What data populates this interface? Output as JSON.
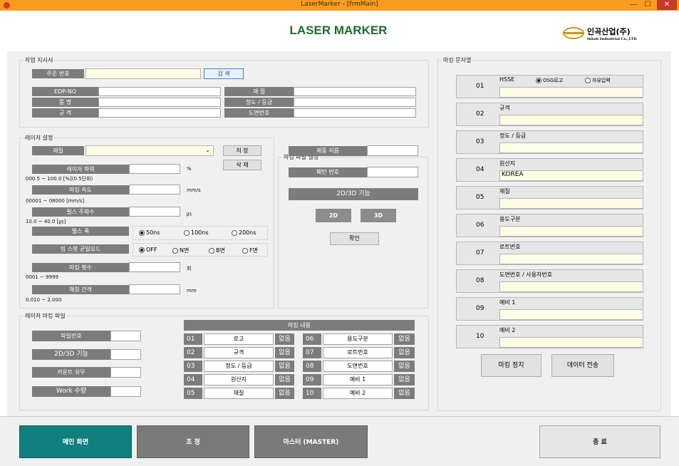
{
  "window": {
    "title": "LaserMarker - [frmMain]",
    "minimize": "—",
    "maximize": "☐",
    "close": "✕"
  },
  "header": {
    "app_title": "LASER MARKER",
    "logo_name": "인곡산업(주)",
    "logo_sub": "Inkok Industrial Co.,LTD"
  },
  "work_order": {
    "group_title": "작업 지시서",
    "order_no_label": "주문 번호",
    "order_no_value": "",
    "search_label": "검 색",
    "edp_label": "EDP-NO",
    "edp_value": "",
    "product_label": "품 명",
    "product_value": "",
    "spec_label": "규 격",
    "spec_value": "",
    "material_label": "재 질",
    "material_value": "",
    "precision_label": "정도 / 등급",
    "precision_value": "",
    "drawing_label": "도면번호",
    "drawing_value": ""
  },
  "laser": {
    "group_title": "레이저 설정",
    "material_label": "재질",
    "material_value": "",
    "save_label": "저 장",
    "delete_label": "삭 제",
    "power_label": "레이저 파워",
    "power_unit": "%",
    "power_range": "000.5 ~ 100.0 [%](0.5단위)",
    "speed_label": "마킹 속도",
    "speed_unit": "mm/s",
    "speed_range": "00001 ~ 08000 [mm/s]",
    "freq_label": "펄스 주파수",
    "freq_unit": "㎲",
    "freq_range": "10.0 ~ 40.0 [㎲]",
    "width_label": "펄스 폭",
    "width_opts": [
      "50ns",
      "100ns",
      "200ns"
    ],
    "beam_label": "빔 스팟 균일모드",
    "beam_opts": [
      "OFF",
      "N면",
      "B면",
      "F면"
    ],
    "count_label": "마킹 횟수",
    "count_unit": "회",
    "count_range": "0001 ~ 9999",
    "hatch_label": "해칭 간격",
    "hatch_unit": "mm",
    "hatch_range": "0.010 ~ 2.000"
  },
  "file_settings": {
    "group_title": "마킹 파일 설정",
    "product_label": "제품 지름",
    "pattern_label": "패턴 번호",
    "func_label": "2D/3D 기능",
    "btn_2d": "2D",
    "btn_3d": "3D",
    "ok_label": "확인"
  },
  "laser_file": {
    "group_title": "레이저 마킹 파일",
    "file_no_label": "파일번호",
    "func_label": "2D/3D 기능",
    "count_label": "카운트 유무",
    "work_label": "Work 수량"
  },
  "marking_contents": {
    "title": "마킹 내용",
    "none": "없음",
    "left": [
      {
        "n": "01",
        "name": "로고"
      },
      {
        "n": "02",
        "name": "규격"
      },
      {
        "n": "03",
        "name": "정도 / 등급"
      },
      {
        "n": "04",
        "name": "원산지"
      },
      {
        "n": "05",
        "name": "재질"
      }
    ],
    "right": [
      {
        "n": "06",
        "name": "용도구분"
      },
      {
        "n": "07",
        "name": "로트번호"
      },
      {
        "n": "08",
        "name": "도면번호"
      },
      {
        "n": "09",
        "name": "예비 1"
      },
      {
        "n": "10",
        "name": "예비 2"
      }
    ]
  },
  "marking_strings": {
    "group_title": "마킹 문자열",
    "osg_label": "OSG로고",
    "free_label": "자유입력",
    "rows": [
      {
        "n": "01",
        "label": "HSSE",
        "value": ""
      },
      {
        "n": "02",
        "label": "규격",
        "value": ""
      },
      {
        "n": "03",
        "label": "정도 / 등급",
        "value": ""
      },
      {
        "n": "04",
        "label": "원산지",
        "value": "KOREA"
      },
      {
        "n": "05",
        "label": "재질",
        "value": ""
      },
      {
        "n": "06",
        "label": "용도구분",
        "value": ""
      },
      {
        "n": "07",
        "label": "로트번호",
        "value": ""
      },
      {
        "n": "08",
        "label": "도면번호 / 사용자번호",
        "value": ""
      },
      {
        "n": "09",
        "label": "예비 1",
        "value": ""
      },
      {
        "n": "10",
        "label": "예비 2",
        "value": ""
      }
    ],
    "stop_label": "마킹 정지",
    "send_label": "데이터 전송"
  },
  "footer": {
    "main_label": "메인 화면",
    "adjust_label": "조 정",
    "master_label": "마스터 (MASTER)",
    "exit_label": "종 료",
    "colors": {
      "main": "#0f7f7f",
      "gray": "#7a7a7a"
    }
  }
}
